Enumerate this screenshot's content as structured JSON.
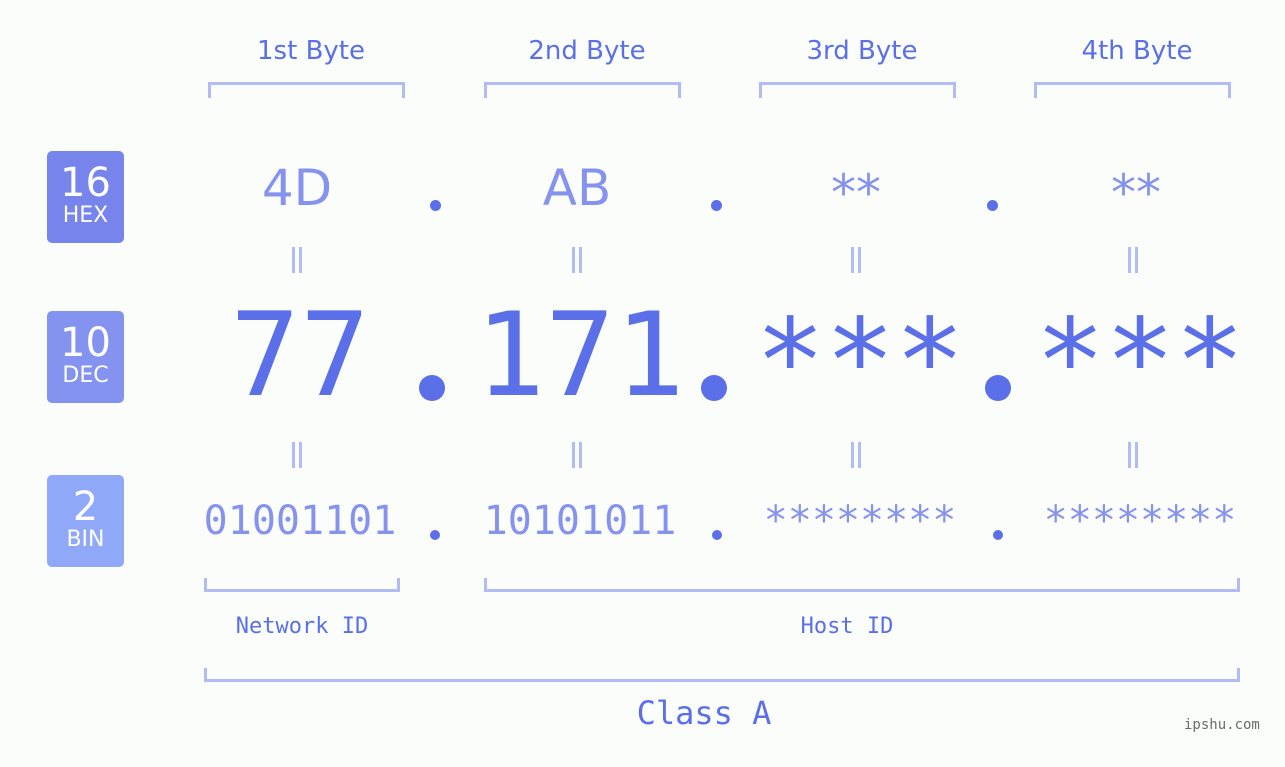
{
  "bytes": {
    "headers": [
      "1st Byte",
      "2nd Byte",
      "3rd Byte",
      "4th Byte"
    ]
  },
  "bases": [
    {
      "number": "16",
      "label": "HEX",
      "color": "#7684ec"
    },
    {
      "number": "10",
      "label": "DEC",
      "color": "#8493f0"
    },
    {
      "number": "2",
      "label": "BIN",
      "color": "#8fa8f8"
    }
  ],
  "rows": {
    "hex": [
      "4D",
      "AB",
      "**",
      "**"
    ],
    "dec": [
      "77",
      "171",
      "***",
      "***"
    ],
    "bin": [
      "01001101",
      "10101011",
      "********",
      "********"
    ]
  },
  "separator": ".",
  "segments": {
    "network_label": "Network ID",
    "host_label": "Host ID",
    "class_label": "Class A"
  },
  "watermark": "ipshu.com",
  "colors": {
    "primary": "#5a6fe8",
    "light": "#8693ee",
    "bracket": "#b1bcf5",
    "background": "#fbfdfb"
  }
}
